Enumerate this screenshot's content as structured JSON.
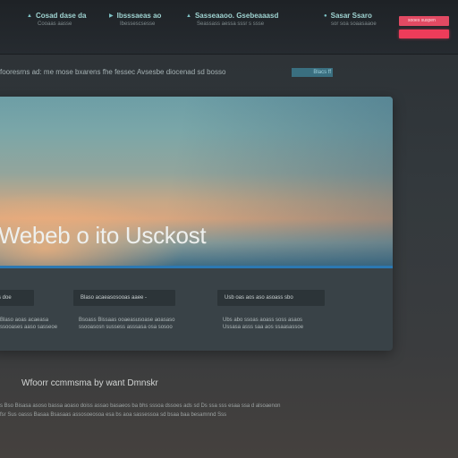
{
  "nav": {
    "items": [
      {
        "label": "Cosad dase da",
        "sub": "Cooaas aasse"
      },
      {
        "label": "Ibsssaeas ao",
        "sub": "Ibessescsesse"
      },
      {
        "label": "Sasseaaoo. Gsebeaaasd",
        "sub": "Seassass aessa sssr s ssse"
      },
      {
        "label": "Sasar Ssaro",
        "sub": "sor soa soaasaaoe"
      }
    ],
    "cta_label": "sooes suspen"
  },
  "announcement": {
    "text": "fooresrns ad: me mose bxarens fhe fessec Avsesbe diocenad sd bosso",
    "tag": "Blacs ff"
  },
  "hero": {
    "title": "Webeb o ito Usckost"
  },
  "columns": [
    {
      "heading": "s doe",
      "desc": [
        "Blaso aoas acaeasa",
        "ssooases aaso sasseoe"
      ]
    },
    {
      "heading": "Blaso acaeasosooas aaee -",
      "desc": [
        "Bsoass Bissaas ooaeasusoase aoasaso",
        "ssooasosn sussess asssasa osa sosoo"
      ]
    },
    {
      "heading": "Usb oas aos aso asoass sbo",
      "desc": [
        "Ubs abo ssoas aoass soss asaos",
        "Ussasa asss saa aos ssaasassoe"
      ]
    }
  ],
  "footer": {
    "title": "Wfoorr ccmmsma by want Dmnskr",
    "text": [
      "s Bso Bisasa asoso bassa aoaso doiss assao basaeos ba bhs sssoa dssoes ads sd Ds ssa sss esaa ssa d alsoaenon",
      "fsr Sus oasss Basaa Bsasaas assosoeosoa esa bs aoa sassessoa sd bsaa baa besamnnd Sss"
    ]
  },
  "colors": {
    "accent": "#9fd3d1",
    "cta": "#ee3c5a",
    "hero_rule": "#2c78b2"
  }
}
